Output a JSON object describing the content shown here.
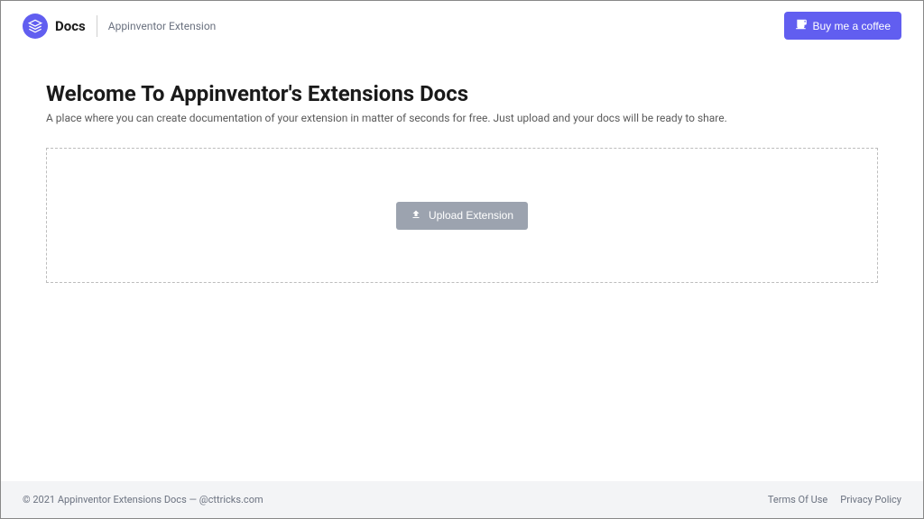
{
  "header": {
    "logo_text": "Docs",
    "subtitle": "Appinventor Extension",
    "coffee_label": "Buy me a coffee"
  },
  "main": {
    "title": "Welcome To Appinventor's Extensions Docs",
    "description": "A place where you can create documentation of your extension in matter of seconds for free. Just upload and your docs will be ready to share.",
    "upload_label": "Upload Extension"
  },
  "footer": {
    "copyright": "© 2021 Appinventor Extensions Docs — @cttricks.com",
    "terms": "Terms Of Use",
    "privacy": "Privacy Policy"
  }
}
